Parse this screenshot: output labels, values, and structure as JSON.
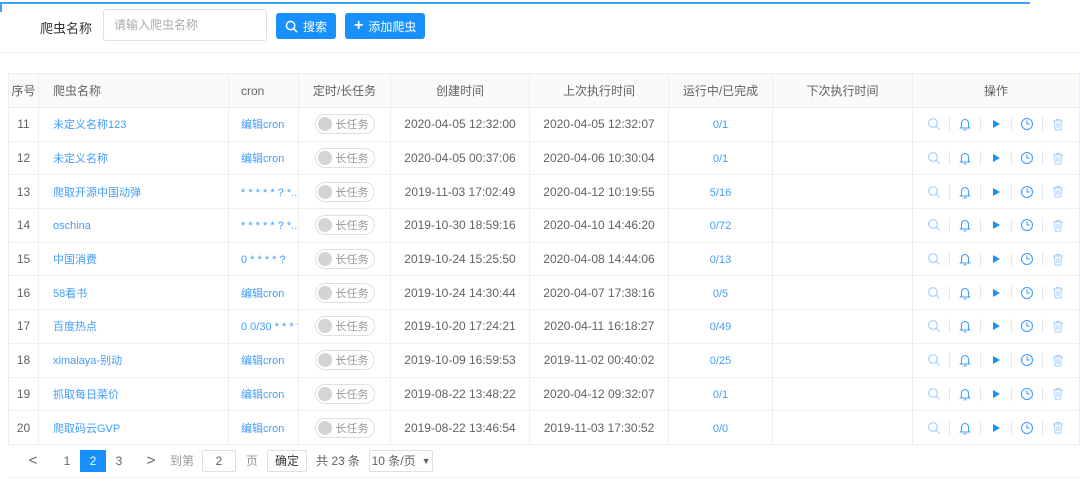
{
  "search": {
    "label": "爬虫名称",
    "placeholder": "请输入爬虫名称",
    "search_btn": "搜索",
    "add_btn": "添加爬虫"
  },
  "columns": [
    "序号",
    "爬虫名称",
    "cron",
    "定时/长任务",
    "创建时间",
    "上次执行时间",
    "运行中/已完成",
    "下次执行时间",
    "操作"
  ],
  "toggle_label": "长任务",
  "rows": [
    {
      "no": "11",
      "name": "未定义名称123",
      "cron": "编辑cron",
      "created": "2020-04-05 12:32:00",
      "last": "2020-04-05 12:32:07",
      "status": "0/1",
      "next": ""
    },
    {
      "no": "12",
      "name": "未定义名称",
      "cron": "编辑cron",
      "created": "2020-04-05 00:37:06",
      "last": "2020-04-06 10:30:04",
      "status": "0/1",
      "next": ""
    },
    {
      "no": "13",
      "name": "爬取开源中国动弹",
      "cron": "* * * * * ? *...",
      "created": "2019-11-03 17:02:49",
      "last": "2020-04-12 10:19:55",
      "status": "5/16",
      "next": ""
    },
    {
      "no": "14",
      "name": "oschina",
      "cron": "* * * * * ? *...",
      "created": "2019-10-30 18:59:16",
      "last": "2020-04-10 14:46:20",
      "status": "0/72",
      "next": ""
    },
    {
      "no": "15",
      "name": "中国消费",
      "cron": "0 * * * * ?",
      "created": "2019-10-24 15:25:50",
      "last": "2020-04-08 14:44:06",
      "status": "0/13",
      "next": ""
    },
    {
      "no": "16",
      "name": "58看书",
      "cron": "编辑cron",
      "created": "2019-10-24 14:30:44",
      "last": "2020-04-07 17:38:16",
      "status": "0/5",
      "next": ""
    },
    {
      "no": "17",
      "name": "百度热点",
      "cron": "0 0/30 * * * ?",
      "created": "2019-10-20 17:24:21",
      "last": "2020-04-11 16:18:27",
      "status": "0/49",
      "next": ""
    },
    {
      "no": "18",
      "name": "ximalaya-别动",
      "cron": "编辑cron",
      "created": "2019-10-09 16:59:53",
      "last": "2019-11-02 00:40:02",
      "status": "0/25",
      "next": ""
    },
    {
      "no": "19",
      "name": "抓取每日菜价",
      "cron": "编辑cron",
      "created": "2019-08-22 13:48:22",
      "last": "2020-04-12 09:32:07",
      "status": "0/1",
      "next": ""
    },
    {
      "no": "20",
      "name": "爬取码云GVP",
      "cron": "编辑cron",
      "created": "2019-08-22 13:46:54",
      "last": "2019-11-03 17:30:52",
      "status": "0/0",
      "next": ""
    }
  ],
  "ops_icons": [
    "search-icon",
    "bell-icon",
    "play-icon",
    "clock-icon",
    "trash-icon"
  ],
  "pager": {
    "prev": "<",
    "pages": [
      "1",
      "2",
      "3"
    ],
    "current": "2",
    "next": ">",
    "goto_label": "到第",
    "goto_value": "2",
    "page_unit": "页",
    "confirm": "确定",
    "total": "共 23 条",
    "page_size": "10 条/页"
  },
  "colors": {
    "primary": "#1890ff",
    "link": "#409eff"
  }
}
